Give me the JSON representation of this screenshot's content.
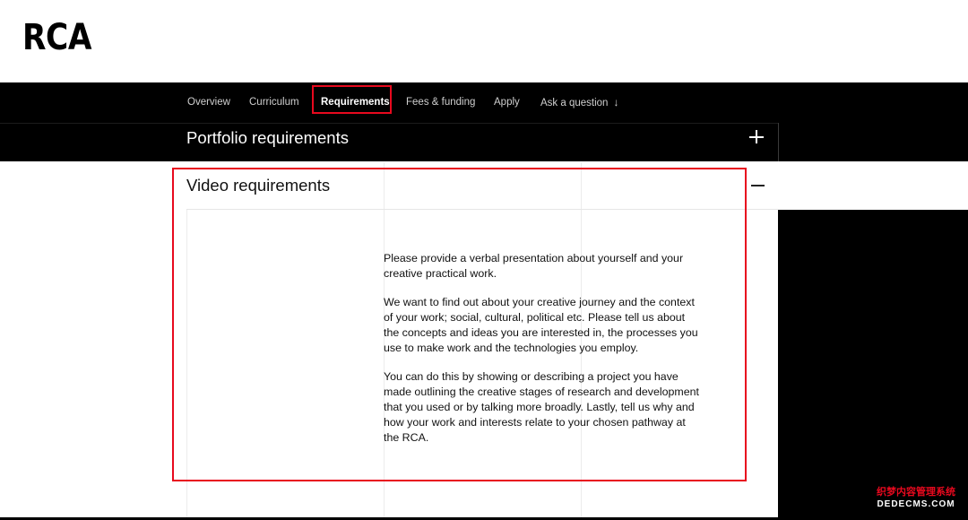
{
  "header": {
    "logo": "RCA"
  },
  "nav": {
    "items": [
      {
        "label": "Overview",
        "active": false
      },
      {
        "label": "Curriculum",
        "active": false
      },
      {
        "label": "Requirements",
        "active": true
      },
      {
        "label": "Fees & funding",
        "active": false
      },
      {
        "label": "Apply",
        "active": false
      },
      {
        "label": "Ask a question",
        "active": false,
        "icon": "arrow-down-icon"
      }
    ]
  },
  "accordion": {
    "portfolio": {
      "title": "Portfolio requirements",
      "state": "collapsed",
      "icon": "plus-icon"
    },
    "video": {
      "title": "Video requirements",
      "state": "expanded",
      "icon": "minus-icon",
      "paragraphs": [
        "Please provide a verbal presentation about yourself and your creative practical work.",
        "We want to find out about your creative journey and the context of your work; social, cultural, political etc. Please tell us about the concepts and ideas you are interested in, the processes you use to make work and the technologies you employ.",
        "You can do this by showing or describing a project you have made outlining the creative stages of research and development that you used or by talking more broadly. Lastly, tell us why and how your work and interests relate to your chosen pathway at the RCA."
      ]
    }
  },
  "watermark": {
    "line1": "织梦内容管理系统",
    "line2": "DEDECMS.COM"
  },
  "colors": {
    "highlight": "#e8091e",
    "nav_bg": "#000000",
    "page_bg": "#ffffff"
  }
}
